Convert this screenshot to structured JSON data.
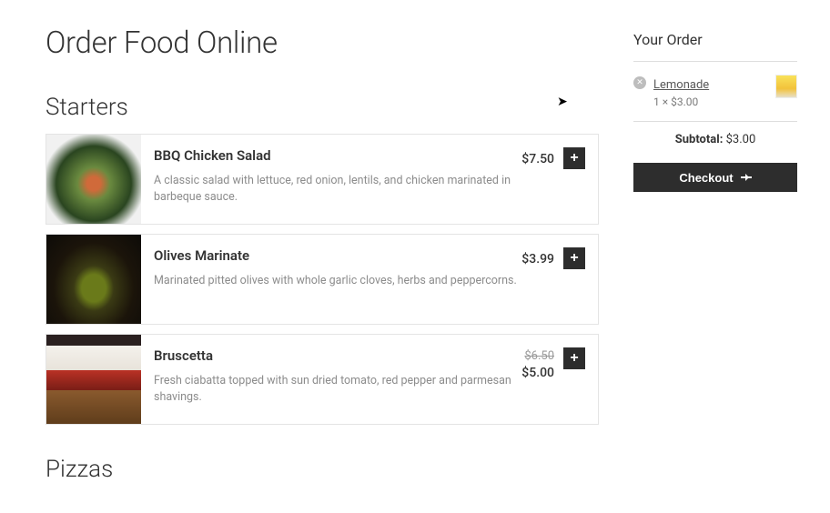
{
  "page": {
    "title": "Order Food Online"
  },
  "sections": {
    "starters": "Starters",
    "pizzas": "Pizzas"
  },
  "items": [
    {
      "name": "BBQ Chicken Salad",
      "desc": "A classic salad with lettuce, red onion, lentils, and chicken marinated in barbeque sauce.",
      "price": "$7.50",
      "price_old": ""
    },
    {
      "name": "Olives Marinate",
      "desc": "Marinated pitted olives with whole garlic cloves, herbs and peppercorns.",
      "price": "$3.99",
      "price_old": ""
    },
    {
      "name": "Bruscetta",
      "desc": "Fresh ciabatta topped with sun dried tomato, red pepper and parmesan shavings.",
      "price": "$5.00",
      "price_old": "$6.50"
    }
  ],
  "cart": {
    "title": "Your Order",
    "line": {
      "name": "Lemonade",
      "qty": "1 × $3.00"
    },
    "subtotal_label": "Subtotal:",
    "subtotal_value": "$3.00",
    "checkout_label": "Checkout"
  },
  "glyphs": {
    "plus": "+",
    "remove": "✕"
  }
}
